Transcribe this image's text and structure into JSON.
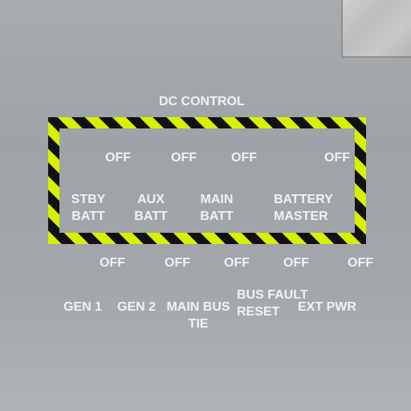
{
  "panel": {
    "title": "DC CONTROL",
    "top_switches": [
      {
        "state": "OFF",
        "label": "STBY\nBATT"
      },
      {
        "state": "OFF",
        "label": "AUX\nBATT"
      },
      {
        "state": "OFF",
        "label": "MAIN\nBATT"
      },
      {
        "state": "OFF",
        "label": "BATTERY\nMASTER"
      }
    ],
    "bottom_switches": [
      {
        "state": "OFF",
        "label": "GEN 1"
      },
      {
        "state": "OFF",
        "label": "GEN 2"
      },
      {
        "state": "OFF",
        "label": "MAIN BUS\nTIE"
      },
      {
        "state": "OFF",
        "label": "BUS FAULT\nRESET"
      },
      {
        "state": "OFF",
        "label": "EXT PWR"
      }
    ],
    "colors": {
      "stripe_yellow": "#d8f000",
      "stripe_black": "#111111",
      "text": "#f2f2f2"
    }
  }
}
